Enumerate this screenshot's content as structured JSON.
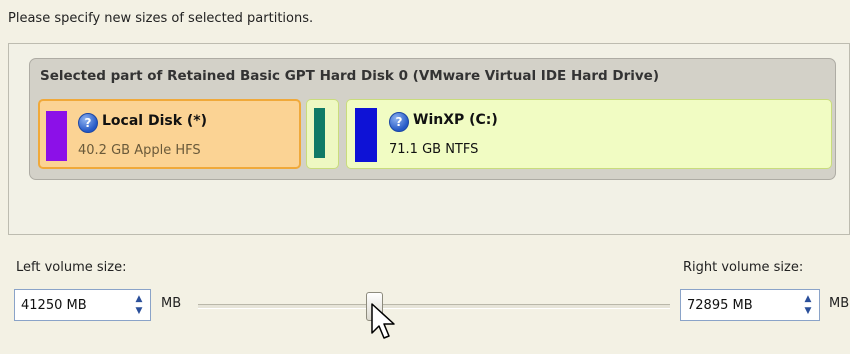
{
  "instruction": "Please specify new sizes of selected partitions.",
  "disk_map": {
    "title": "Selected part of Retained Basic GPT Hard Disk 0 (VMware Virtual IDE Hard Drive)",
    "partitions": [
      {
        "name": "Local Disk (*)",
        "detail": "40.2 GB Apple HFS",
        "color": "#8c10e8",
        "state": "selected"
      },
      {
        "name": "",
        "detail": "",
        "color": "#107a66"
      },
      {
        "name": "WinXP (C:)",
        "detail": "71.1 GB NTFS",
        "color": "#0e12d6"
      }
    ]
  },
  "left": {
    "label": "Left volume size:",
    "value": "41250 MB",
    "unit": "MB"
  },
  "right": {
    "label": "Right volume size:",
    "value": "72895 MB",
    "unit": "MB"
  },
  "colors": {
    "selected_border": "#f0a93a",
    "selected_bg": "#fbd394",
    "partition_bg": "#f1fcc3"
  },
  "icons": {
    "help": "help-icon",
    "spin_up": "spin-up-icon",
    "spin_down": "spin-down-icon",
    "cursor": "mouse-pointer-icon"
  }
}
